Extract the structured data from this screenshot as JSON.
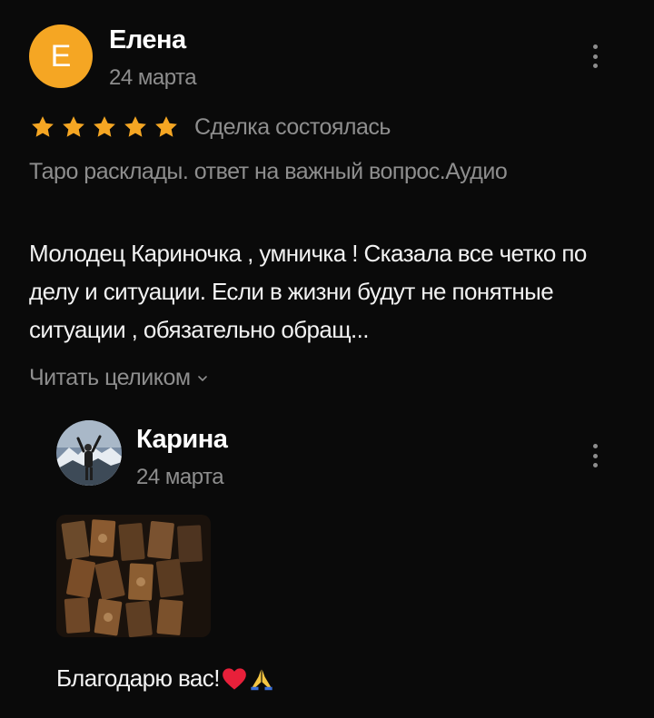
{
  "review": {
    "author": {
      "initial": "Е",
      "name": "Елена",
      "date": "24 марта",
      "avatar_color": "#f5a623"
    },
    "rating": 5,
    "star_color": "#f5a623",
    "deal_status": "Сделка состоялась",
    "service_title": "Таро расклады. ответ на важный вопрос.Аудио",
    "text": "Молодец  Кариночка , умничка  ! Сказала все четко по делу и ситуации. Если в жизни будут не понятные ситуации , обязательно обращ...",
    "read_more_label": "Читать целиком",
    "menu_icon": "more-vertical-icon"
  },
  "reply": {
    "author": {
      "name": "Карина",
      "date": "24 марта",
      "avatar_icon": "profile-photo"
    },
    "attachment_icon": "tarot-cards-photo",
    "text": "Благодарю вас!",
    "emoji": [
      "heart-icon",
      "praying-hands-icon"
    ],
    "menu_icon": "more-vertical-icon"
  }
}
